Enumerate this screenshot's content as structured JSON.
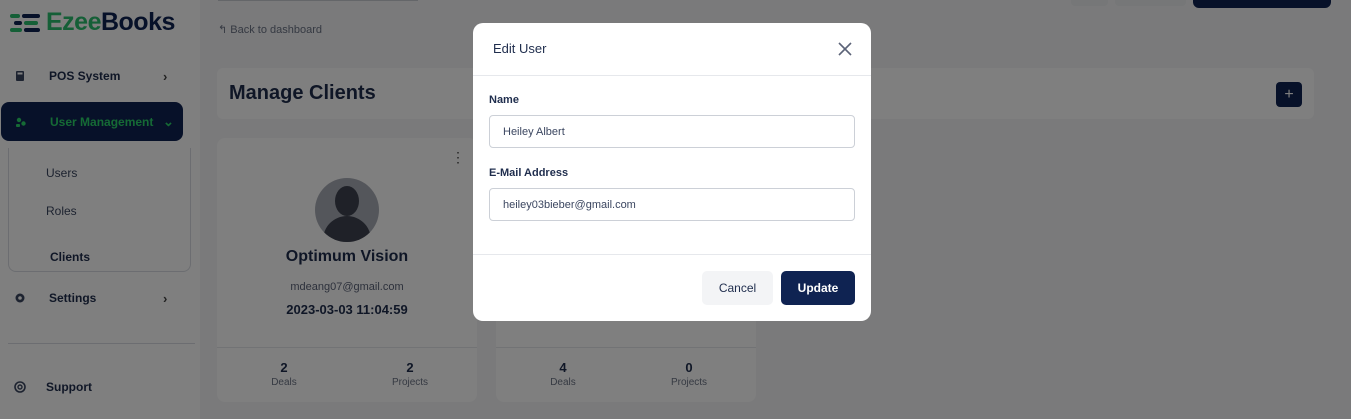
{
  "app": {
    "logo_part1": "Ezee",
    "logo_part2": "Books",
    "brand_green": "#2bbf6e",
    "brand_navy": "#0f2352"
  },
  "sidebar": {
    "items": [
      {
        "label": "POS System",
        "icon": "pos-icon"
      },
      {
        "label": "User Management",
        "icon": "users-icon",
        "active": true
      },
      {
        "label": "Settings",
        "icon": "gear-icon"
      },
      {
        "label": "Support",
        "icon": "support-icon"
      }
    ],
    "submenu": [
      "Users",
      "Roles",
      "Clients"
    ]
  },
  "main": {
    "back_link": "Back to dashboard",
    "title": "Manage Clients",
    "add_label": "+",
    "cards": [
      {
        "name": "Optimum Vision",
        "email": "mdeang07@gmail.com",
        "date": "2023-03-03 11:04:59",
        "deals": "2",
        "projects": "2",
        "deals_label": "Deals",
        "projects_label": "Projects"
      },
      {
        "deals": "4",
        "projects": "0",
        "deals_label": "Deals",
        "projects_label": "Projects"
      }
    ]
  },
  "modal": {
    "title": "Edit User",
    "name_label": "Name",
    "name_value": "Heiley Albert",
    "email_label": "E-Mail Address",
    "email_value": "heiley03bieber@gmail.com",
    "cancel_label": "Cancel",
    "update_label": "Update"
  }
}
